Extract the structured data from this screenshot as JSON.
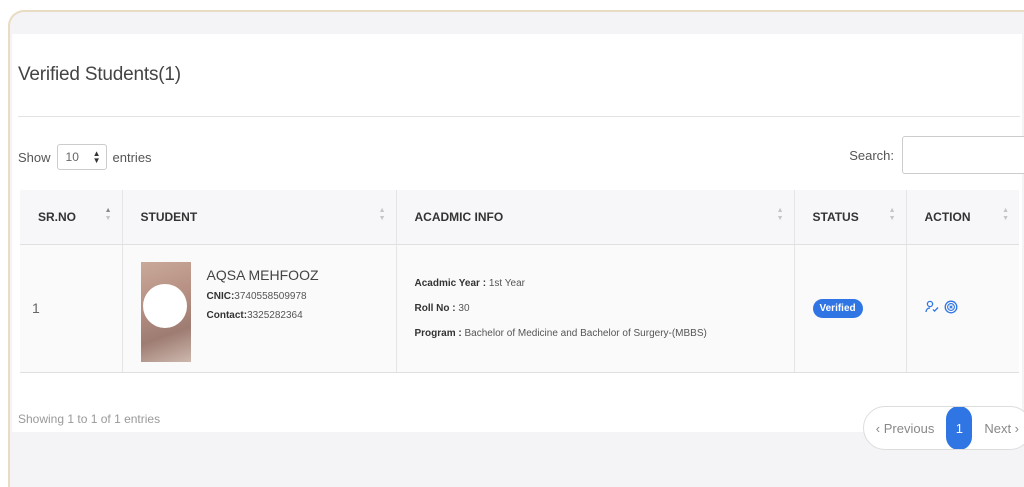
{
  "card": {
    "title": "Verified Students(1)"
  },
  "controls": {
    "show_label": "Show",
    "entries_value": "10",
    "entries_label": "entries",
    "search_label": "Search:"
  },
  "table": {
    "headers": [
      "SR.NO",
      "STUDENT",
      "ACADMIC INFO",
      "STATUS",
      "ACTION"
    ],
    "rows": [
      {
        "srno": "1",
        "student": {
          "name": "AQSA MEHFOOZ",
          "cnic_label": "CNIC:",
          "cnic": "3740558509978",
          "contact_label": "Contact:",
          "contact": "3325282364"
        },
        "acadmic": {
          "year_label": "Acadmic Year : ",
          "year": "1st Year",
          "roll_label": "Roll No : ",
          "roll": "30",
          "program_label": "Program : ",
          "program": "Bachelor of Medicine and Bachelor of Surgery-(MBBS)"
        },
        "status": "Verified",
        "actions": [
          "user-check-icon",
          "circle-x-icon"
        ]
      }
    ]
  },
  "footer": {
    "info": "Showing 1 to 1 of 1 entries",
    "previous": "‹ Previous",
    "current_page": "1",
    "next": "Next ›"
  },
  "colors": {
    "accent": "#2f75e4",
    "frame_border": "#e8dcc4"
  }
}
